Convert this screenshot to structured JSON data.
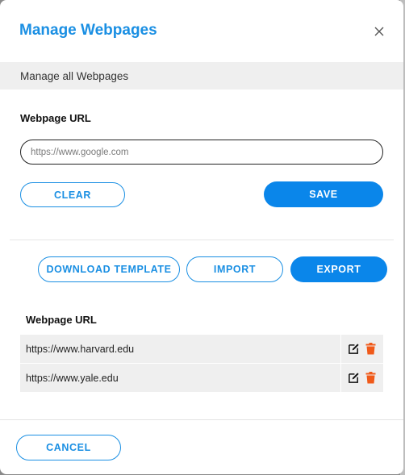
{
  "modal": {
    "title": "Manage Webpages",
    "subtitle": "Manage all Webpages"
  },
  "form": {
    "label": "Webpage URL",
    "placeholder": "https://www.google.com",
    "clear_label": "CLEAR",
    "save_label": "SAVE"
  },
  "actions": {
    "download_label": "DOWNLOAD TEMPLATE",
    "import_label": "IMPORT",
    "export_label": "EXPORT"
  },
  "table": {
    "header": "Webpage URL",
    "rows": [
      {
        "url": "https://www.harvard.edu"
      },
      {
        "url": "https://www.yale.edu"
      }
    ]
  },
  "footer": {
    "cancel_label": "CANCEL"
  },
  "colors": {
    "accent": "#1a8fe3",
    "primary_button": "#0a86ea",
    "delete_icon": "#f05a1a"
  },
  "icons": {
    "close": "close-icon",
    "edit": "edit-icon",
    "delete": "trash-icon"
  }
}
